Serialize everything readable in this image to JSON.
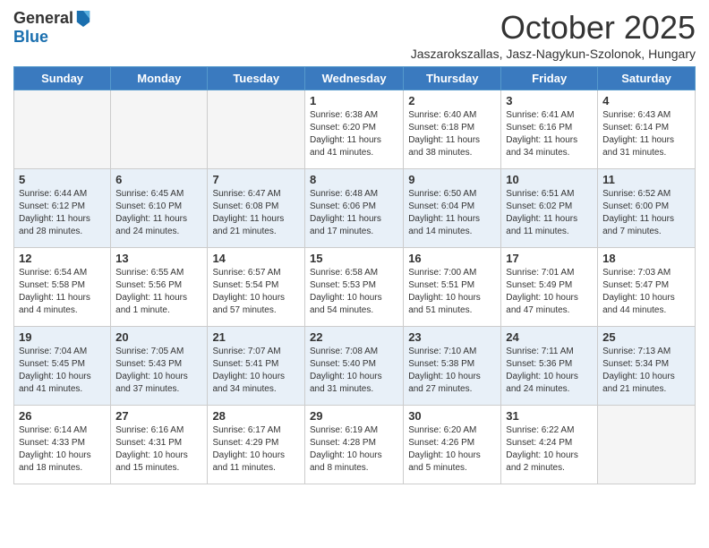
{
  "logo": {
    "general": "General",
    "blue": "Blue"
  },
  "header": {
    "month": "October 2025",
    "location": "Jaszarokszallas, Jasz-Nagykun-Szolonok, Hungary"
  },
  "days_of_week": [
    "Sunday",
    "Monday",
    "Tuesday",
    "Wednesday",
    "Thursday",
    "Friday",
    "Saturday"
  ],
  "weeks": [
    [
      {
        "day": "",
        "info": ""
      },
      {
        "day": "",
        "info": ""
      },
      {
        "day": "",
        "info": ""
      },
      {
        "day": "1",
        "info": "Sunrise: 6:38 AM\nSunset: 6:20 PM\nDaylight: 11 hours\nand 41 minutes."
      },
      {
        "day": "2",
        "info": "Sunrise: 6:40 AM\nSunset: 6:18 PM\nDaylight: 11 hours\nand 38 minutes."
      },
      {
        "day": "3",
        "info": "Sunrise: 6:41 AM\nSunset: 6:16 PM\nDaylight: 11 hours\nand 34 minutes."
      },
      {
        "day": "4",
        "info": "Sunrise: 6:43 AM\nSunset: 6:14 PM\nDaylight: 11 hours\nand 31 minutes."
      }
    ],
    [
      {
        "day": "5",
        "info": "Sunrise: 6:44 AM\nSunset: 6:12 PM\nDaylight: 11 hours\nand 28 minutes."
      },
      {
        "day": "6",
        "info": "Sunrise: 6:45 AM\nSunset: 6:10 PM\nDaylight: 11 hours\nand 24 minutes."
      },
      {
        "day": "7",
        "info": "Sunrise: 6:47 AM\nSunset: 6:08 PM\nDaylight: 11 hours\nand 21 minutes."
      },
      {
        "day": "8",
        "info": "Sunrise: 6:48 AM\nSunset: 6:06 PM\nDaylight: 11 hours\nand 17 minutes."
      },
      {
        "day": "9",
        "info": "Sunrise: 6:50 AM\nSunset: 6:04 PM\nDaylight: 11 hours\nand 14 minutes."
      },
      {
        "day": "10",
        "info": "Sunrise: 6:51 AM\nSunset: 6:02 PM\nDaylight: 11 hours\nand 11 minutes."
      },
      {
        "day": "11",
        "info": "Sunrise: 6:52 AM\nSunset: 6:00 PM\nDaylight: 11 hours\nand 7 minutes."
      }
    ],
    [
      {
        "day": "12",
        "info": "Sunrise: 6:54 AM\nSunset: 5:58 PM\nDaylight: 11 hours\nand 4 minutes."
      },
      {
        "day": "13",
        "info": "Sunrise: 6:55 AM\nSunset: 5:56 PM\nDaylight: 11 hours\nand 1 minute."
      },
      {
        "day": "14",
        "info": "Sunrise: 6:57 AM\nSunset: 5:54 PM\nDaylight: 10 hours\nand 57 minutes."
      },
      {
        "day": "15",
        "info": "Sunrise: 6:58 AM\nSunset: 5:53 PM\nDaylight: 10 hours\nand 54 minutes."
      },
      {
        "day": "16",
        "info": "Sunrise: 7:00 AM\nSunset: 5:51 PM\nDaylight: 10 hours\nand 51 minutes."
      },
      {
        "day": "17",
        "info": "Sunrise: 7:01 AM\nSunset: 5:49 PM\nDaylight: 10 hours\nand 47 minutes."
      },
      {
        "day": "18",
        "info": "Sunrise: 7:03 AM\nSunset: 5:47 PM\nDaylight: 10 hours\nand 44 minutes."
      }
    ],
    [
      {
        "day": "19",
        "info": "Sunrise: 7:04 AM\nSunset: 5:45 PM\nDaylight: 10 hours\nand 41 minutes."
      },
      {
        "day": "20",
        "info": "Sunrise: 7:05 AM\nSunset: 5:43 PM\nDaylight: 10 hours\nand 37 minutes."
      },
      {
        "day": "21",
        "info": "Sunrise: 7:07 AM\nSunset: 5:41 PM\nDaylight: 10 hours\nand 34 minutes."
      },
      {
        "day": "22",
        "info": "Sunrise: 7:08 AM\nSunset: 5:40 PM\nDaylight: 10 hours\nand 31 minutes."
      },
      {
        "day": "23",
        "info": "Sunrise: 7:10 AM\nSunset: 5:38 PM\nDaylight: 10 hours\nand 27 minutes."
      },
      {
        "day": "24",
        "info": "Sunrise: 7:11 AM\nSunset: 5:36 PM\nDaylight: 10 hours\nand 24 minutes."
      },
      {
        "day": "25",
        "info": "Sunrise: 7:13 AM\nSunset: 5:34 PM\nDaylight: 10 hours\nand 21 minutes."
      }
    ],
    [
      {
        "day": "26",
        "info": "Sunrise: 6:14 AM\nSunset: 4:33 PM\nDaylight: 10 hours\nand 18 minutes."
      },
      {
        "day": "27",
        "info": "Sunrise: 6:16 AM\nSunset: 4:31 PM\nDaylight: 10 hours\nand 15 minutes."
      },
      {
        "day": "28",
        "info": "Sunrise: 6:17 AM\nSunset: 4:29 PM\nDaylight: 10 hours\nand 11 minutes."
      },
      {
        "day": "29",
        "info": "Sunrise: 6:19 AM\nSunset: 4:28 PM\nDaylight: 10 hours\nand 8 minutes."
      },
      {
        "day": "30",
        "info": "Sunrise: 6:20 AM\nSunset: 4:26 PM\nDaylight: 10 hours\nand 5 minutes."
      },
      {
        "day": "31",
        "info": "Sunrise: 6:22 AM\nSunset: 4:24 PM\nDaylight: 10 hours\nand 2 minutes."
      },
      {
        "day": "",
        "info": ""
      }
    ]
  ]
}
